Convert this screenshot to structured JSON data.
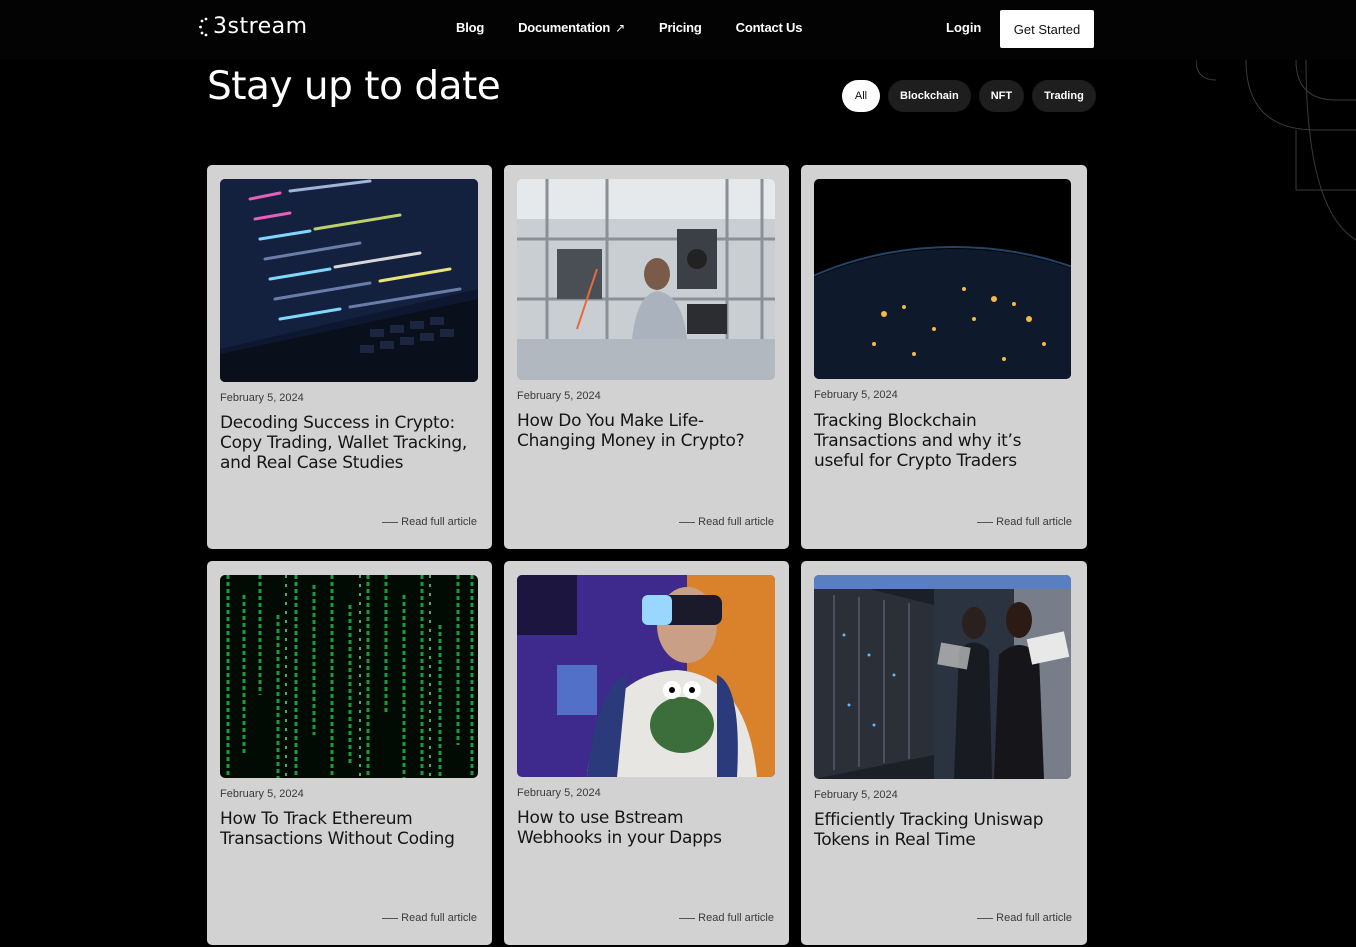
{
  "nav": {
    "logo_text": "3stream",
    "links": [
      {
        "label": "Blog"
      },
      {
        "label": "Documentation",
        "icon": "external-arrow-icon",
        "icon_glyph": "↗"
      },
      {
        "label": "Pricing"
      },
      {
        "label": "Contact Us"
      }
    ],
    "login_label": "Login",
    "cta_label": "Get Started"
  },
  "main": {
    "title": "Stay up to date",
    "filters": [
      {
        "label": "All",
        "active": true
      },
      {
        "label": "Blockchain",
        "active": false
      },
      {
        "label": "NFT",
        "active": false
      },
      {
        "label": "Trading",
        "active": false
      }
    ],
    "read_more_label": "Read full article",
    "articles": [
      {
        "date": "February 5, 2024",
        "title": "Decoding Success in Crypto: Copy Trading, Wallet Tracking, and Real Case Studies",
        "image": "laptop-code-image"
      },
      {
        "date": "February 5, 2024",
        "title": "How Do You Make Life-Changing Money in Crypto?",
        "image": "lab-engineer-image"
      },
      {
        "date": "February 5, 2024",
        "title": "Tracking Blockchain Transactions and why it’s useful for Crypto Traders",
        "image": "earth-night-image"
      },
      {
        "date": "February 5, 2024",
        "title": "How To Track Ethereum Transactions Without Coding",
        "image": "matrix-code-image"
      },
      {
        "date": "February 5, 2024",
        "title": "How to use Bstream Webhooks in your Dapps",
        "image": "vr-headset-image"
      },
      {
        "date": "February 5, 2024",
        "title": "Efficiently Tracking Uniswap Tokens in Real Time",
        "image": "server-room-image"
      }
    ]
  },
  "colors": {
    "background": "#000000",
    "card": "#d2d2d2",
    "chip_idle": "#1e1e1e"
  }
}
